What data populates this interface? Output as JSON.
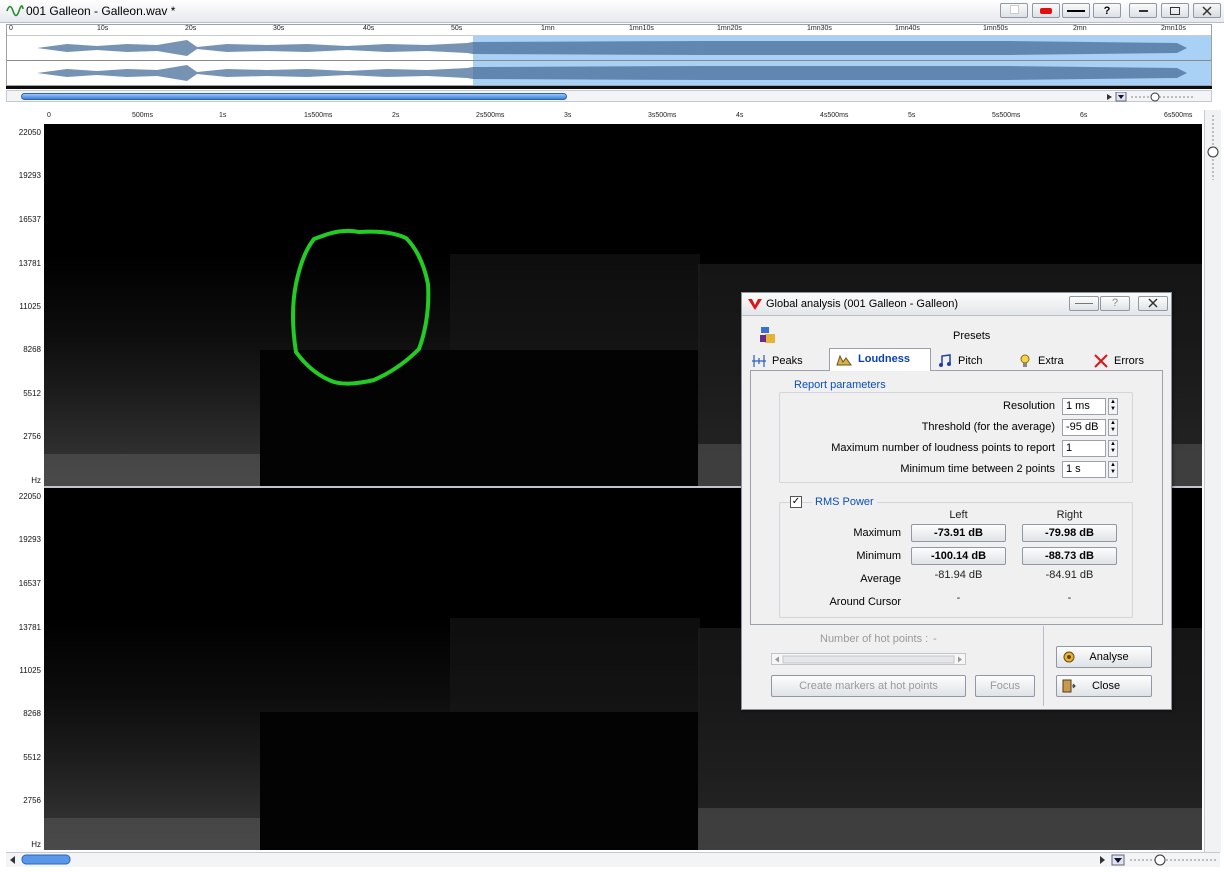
{
  "window": {
    "title": "001 Galleon - Galleon.wav *"
  },
  "titlebar_buttons": {
    "record": "",
    "help": "?"
  },
  "overview_ruler": [
    "0",
    "10s",
    "20s",
    "30s",
    "40s",
    "50s",
    "1mn",
    "1mn10s",
    "1mn20s",
    "1mn30s",
    "1mn40s",
    "1mn50s",
    "2mn",
    "2mn10s"
  ],
  "time_ruler": [
    "0",
    "500ms",
    "1s",
    "1s500ms",
    "2s",
    "2s500ms",
    "3s",
    "3s500ms",
    "4s",
    "4s500ms",
    "5s",
    "5s500ms",
    "6s",
    "6s500ms"
  ],
  "freq_axis": [
    "22050",
    "19293",
    "16537",
    "13781",
    "11025",
    "8268",
    "5512",
    "2756",
    "Hz"
  ],
  "dialog": {
    "title": "Global analysis (001 Galleon - Galleon)",
    "presets_label": "Presets",
    "tabs": [
      {
        "label": "Peaks",
        "icon": "peaks-icon",
        "active": false
      },
      {
        "label": "Loudness",
        "icon": "loudness-icon",
        "active": true
      },
      {
        "label": "Pitch",
        "icon": "music-note-icon",
        "active": false
      },
      {
        "label": "Extra",
        "icon": "lightbulb-icon",
        "active": false
      },
      {
        "label": "Errors",
        "icon": "red-x-icon",
        "active": false
      }
    ],
    "report": {
      "legend": "Report parameters",
      "resolution_label": "Resolution",
      "resolution_value": "1 ms",
      "threshold_label": "Threshold (for the average)",
      "threshold_value": "-95 dB",
      "max_points_label": "Maximum number of loudness points to report",
      "max_points_value": "1",
      "min_time_label": "Minimum time between 2 points",
      "min_time_value": "1 s"
    },
    "rms": {
      "legend": "RMS Power",
      "checked": true,
      "col_left": "Left",
      "col_right": "Right",
      "max_label": "Maximum",
      "max_left": "-73.91 dB",
      "max_right": "-79.98 dB",
      "min_label": "Minimum",
      "min_left": "-100.14 dB",
      "min_right": "-88.73 dB",
      "avg_label": "Average",
      "avg_left": "-81.94 dB",
      "avg_right": "-84.91 dB",
      "cursor_label": "Around Cursor",
      "cursor_left": "-",
      "cursor_right": "-"
    },
    "hot_points_label": "Number of hot points :",
    "hot_points_value": "-",
    "create_markers_label": "Create markers at hot points",
    "focus_label": "Focus",
    "analyse_label": "Analyse",
    "close_label": "Close"
  },
  "colors": {
    "annotation": "#22cc22",
    "waveform_fill": "#a9d0f5",
    "accent": "#0b4fb5"
  }
}
